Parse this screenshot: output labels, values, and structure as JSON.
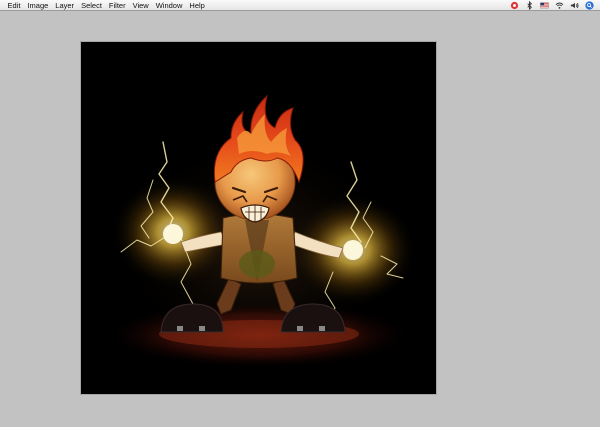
{
  "menubar": {
    "items": [
      {
        "label": "Edit"
      },
      {
        "label": "Image"
      },
      {
        "label": "Layer"
      },
      {
        "label": "Select"
      },
      {
        "label": "Filter"
      },
      {
        "label": "View"
      },
      {
        "label": "Window"
      },
      {
        "label": "Help"
      }
    ],
    "status_icons": [
      "app-badge-icon",
      "bluetooth-icon",
      "flag-icon",
      "wifi-icon",
      "volume-icon",
      "spotlight-icon"
    ]
  },
  "canvas": {
    "background_color": "#c2c2c2",
    "document_background": "#000000",
    "artwork": "fire-character-with-lightning-hands"
  }
}
